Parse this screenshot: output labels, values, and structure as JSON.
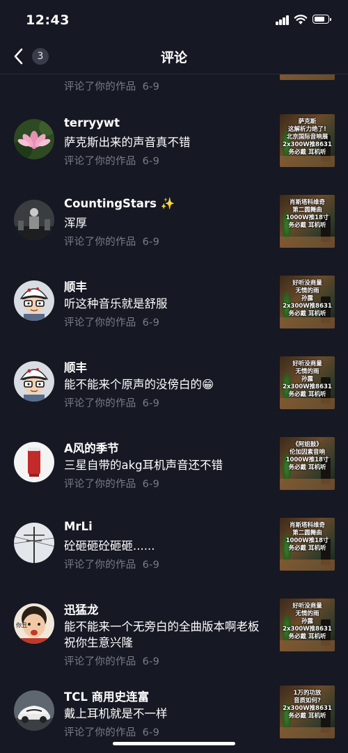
{
  "status_bar": {
    "time": "12:43"
  },
  "header": {
    "title": "评论",
    "unread_count": "3"
  },
  "partial_item": {
    "meta": "评论了你的作品",
    "date": "6-9"
  },
  "comments": [
    {
      "username": "terryywt",
      "text": "萨克斯出来的声音真不错",
      "meta": "评论了你的作品",
      "date": "6-9",
      "avatar": "lotus",
      "thumbnail_caption": "萨克斯\n这解析力绝了!\n北京国际音响展\n2x300W推8631\n务必戴 耳机听"
    },
    {
      "username": "CountingStars ✨",
      "text": "浑厚",
      "meta": "评论了你的作品",
      "date": "6-9",
      "avatar": "concert",
      "thumbnail_caption": "肖斯塔科维奇\n第二圆舞曲\n1000W推18寸\n务必戴 耳机听"
    },
    {
      "username": "顺丰",
      "text": "听这种音乐就是舒服",
      "meta": "评论了你的作品",
      "date": "6-9",
      "avatar": "cartoon",
      "thumbnail_caption": "好听没商量\n无情的雨\n孙露\n2x300W推8631\n务必戴 耳机听"
    },
    {
      "username": "顺丰",
      "text": "能不能来个原声的没傍白的😁",
      "meta": "评论了你的作品",
      "date": "6-9",
      "avatar": "cartoon",
      "thumbnail_caption": "好听没商量\n无情的雨\n孙露\n2x300W推8631\n务必戴 耳机听"
    },
    {
      "username": "A风的季节",
      "text": "三星自带的akg耳机声音还不错",
      "meta": "评论了你的作品",
      "date": "6-9",
      "avatar": "speaker",
      "thumbnail_caption": "《阿姐鼓》\n伦加因素音响\n1000W推18寸\n务必戴 耳机听"
    },
    {
      "username": "MrLi",
      "text": "砼砸砸砼砸砸......",
      "meta": "评论了你的作品",
      "date": "6-9",
      "avatar": "pole",
      "thumbnail_caption": "肖斯塔科维奇\n第二圆舞曲\n1000W推18寸\n务必戴 耳机听"
    },
    {
      "username": "迅猛龙",
      "text": "能不能来一个无旁白的全曲版本啊老板 祝你生意兴隆",
      "meta": "评论了你的作品",
      "date": "6-9",
      "avatar": "kid",
      "thumbnail_caption": "好听没商量\n无情的雨\n孙露\n2x300W推8631\n务必戴 耳机听"
    },
    {
      "username": "TCL 商用史连富",
      "text": "戴上耳机就是不一样",
      "meta": "评论了你的作品",
      "date": "6-9",
      "avatar": "car",
      "thumbnail_caption": "1万的功放\n音质如何?\n2x300W推8631\n务必戴 耳机听"
    }
  ]
}
